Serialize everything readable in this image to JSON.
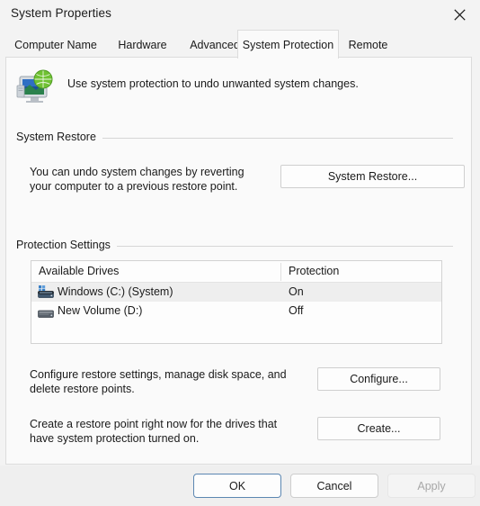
{
  "window": {
    "title": "System Properties",
    "close_icon": "close-icon"
  },
  "tabs": [
    {
      "label": "Computer Name",
      "selected": false
    },
    {
      "label": "Hardware",
      "selected": false
    },
    {
      "label": "Advanced",
      "selected": false
    },
    {
      "label": "System Protection",
      "selected": true
    },
    {
      "label": "Remote",
      "selected": false
    }
  ],
  "header": {
    "icon": "system-protection-icon",
    "description": "Use system protection to undo unwanted system changes."
  },
  "system_restore": {
    "group_label": "System Restore",
    "description_line1": "You can undo system changes by reverting",
    "description_line2": "your computer to a previous restore point.",
    "button_label": "System Restore..."
  },
  "protection_settings": {
    "group_label": "Protection Settings",
    "columns": [
      "Available Drives",
      "Protection"
    ],
    "rows": [
      {
        "icon": "windows-system-drive-icon",
        "drive": "Windows (C:) (System)",
        "protection": "On",
        "selected": true
      },
      {
        "icon": "hard-drive-icon",
        "drive": "New Volume (D:)",
        "protection": "Off",
        "selected": false
      }
    ],
    "configure": {
      "description_line1": "Configure restore settings, manage disk space, and",
      "description_line2": "delete restore points.",
      "button_label": "Configure..."
    },
    "create": {
      "description_line1": "Create a restore point right now for the drives that",
      "description_line2": "have system protection turned on.",
      "button_label": "Create..."
    }
  },
  "footer": {
    "ok_label": "OK",
    "cancel_label": "Cancel",
    "apply_label": "Apply",
    "apply_disabled": true
  },
  "colors": {
    "window_bg": "#f3f3f3",
    "panel_bg": "#fafafa",
    "footer_bg": "#efefef",
    "border": "#dcdcdc",
    "text": "#1a1a1a",
    "disabled_text": "#a7a7a7",
    "focus_border": "#5c87b2",
    "selection_bg": "#eeeeee",
    "drive_accent": "#3a7fc4"
  }
}
